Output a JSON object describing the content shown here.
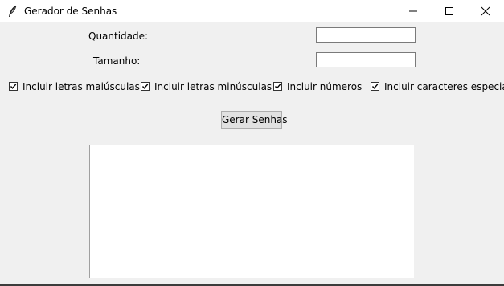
{
  "window": {
    "title": "Gerador de Senhas",
    "app_icon": "feather-icon",
    "controls": [
      "minimize-icon",
      "maximize-icon",
      "close-icon"
    ]
  },
  "form": {
    "quantity_label": "Quantidade:",
    "quantity_value": "",
    "length_label": "Tamanho:",
    "length_value": ""
  },
  "options": [
    {
      "label": "Incluir letras maiúsculas",
      "checked": true
    },
    {
      "label": "Incluir letras minúsculas",
      "checked": true
    },
    {
      "label": "Incluir números",
      "checked": true
    },
    {
      "label": "Incluir caracteres especiais",
      "checked": true
    }
  ],
  "actions": {
    "generate_label": "Gerar Senhas"
  },
  "output": {
    "text": ""
  }
}
